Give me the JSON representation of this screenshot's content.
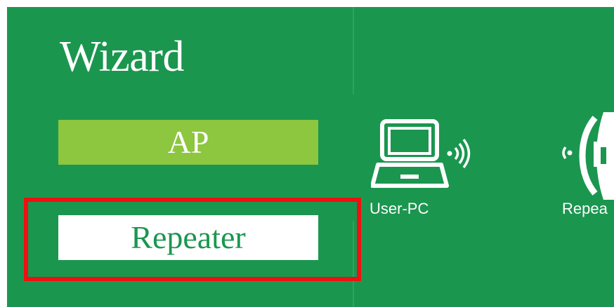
{
  "wizard": {
    "title": "Wizard"
  },
  "modes": {
    "ap_label": "AP",
    "repeater_label": "Repeater"
  },
  "diagram": {
    "user_pc_label": "User-PC",
    "repeater_label": "Repea"
  },
  "colors": {
    "background": "#1b964f",
    "ap_button": "#8dc63f",
    "repeater_button": "#ffffff",
    "highlight": "#ee1111"
  },
  "icons": {
    "user_pc": "laptop-wifi-icon",
    "repeater": "repeater-device-icon"
  }
}
